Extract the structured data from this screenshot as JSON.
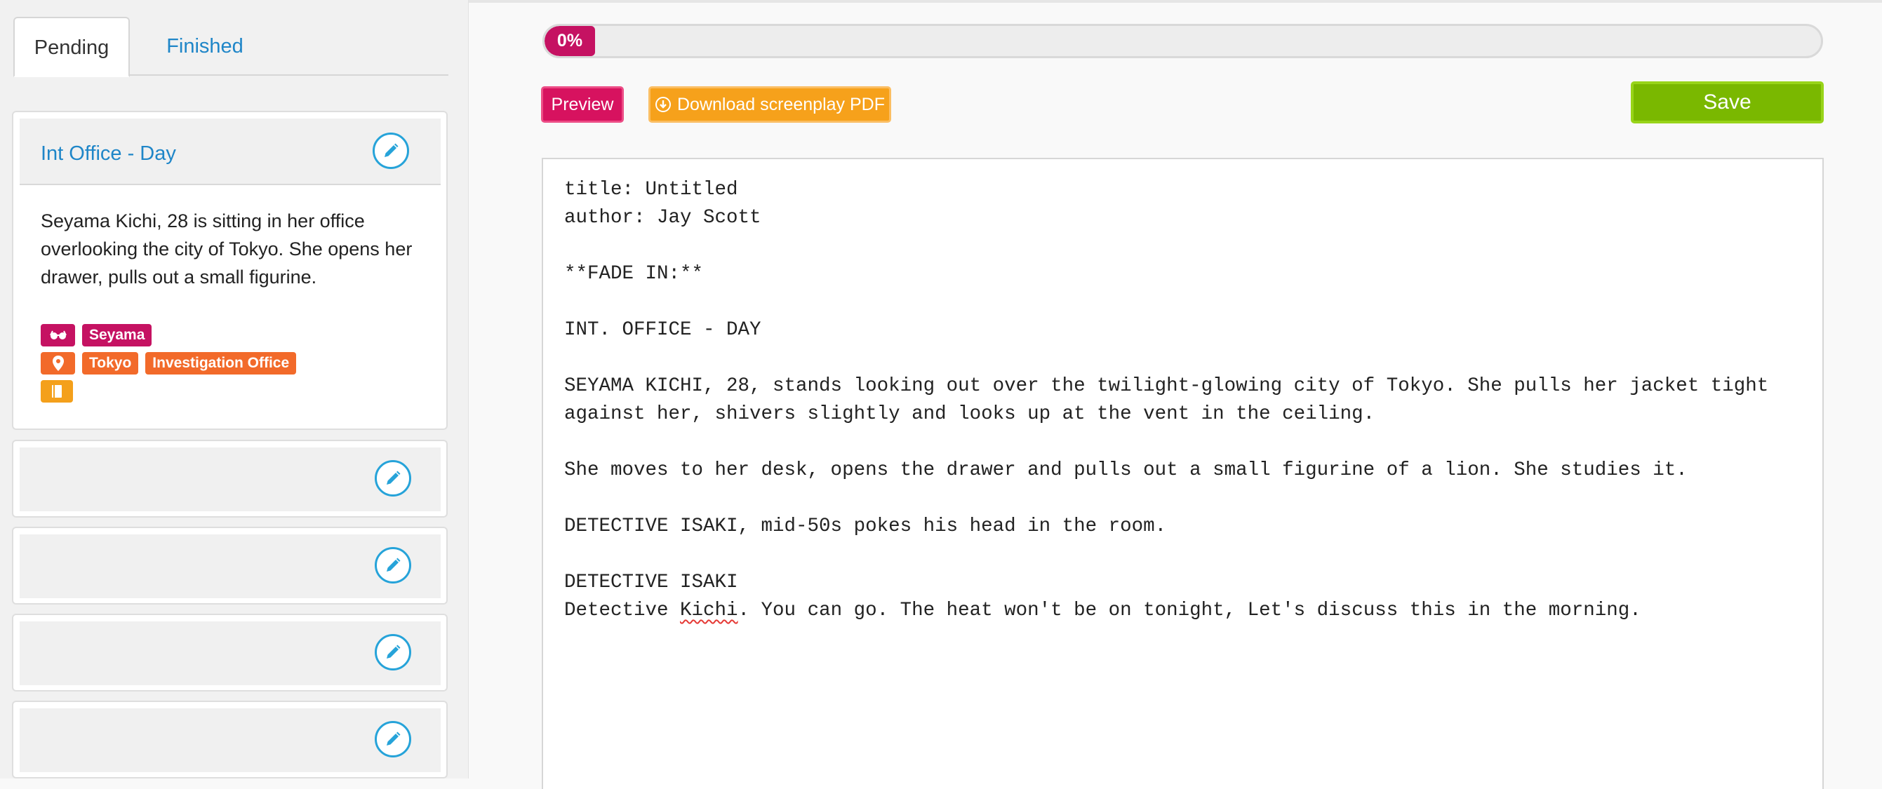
{
  "tabs": {
    "pending_label": "Pending",
    "finished_label": "Finished"
  },
  "scenes": {
    "active": {
      "title": "Int Office - Day",
      "description": "Seyama Kichi, 28 is sitting in her office overlooking the city of Tokyo. She opens her drawer, pulls out a small figurine.",
      "character_tags": [
        "Seyama"
      ],
      "location_tags": [
        "Tokyo",
        "Investigation Office"
      ],
      "tag_icons": {
        "characters": "glasses-icon",
        "locations": "map-pin-icon",
        "notes": "notebook-icon"
      }
    },
    "collapsed_count": 4
  },
  "progress": {
    "label": "0%",
    "value": 0
  },
  "toolbar": {
    "preview_label": "Preview",
    "download_label": "Download screenplay PDF",
    "save_label": "Save"
  },
  "script": {
    "lines": [
      "title: Untitled",
      "author: Jay Scott",
      "",
      "**FADE IN:**",
      "",
      "INT. OFFICE - DAY",
      "",
      "SEYAMA KICHI, 28, stands looking out over the twilight-glowing city of Tokyo. She pulls her jacket tight",
      "against her, shivers slightly and looks up at the vent in the ceiling.",
      "",
      "She moves to her desk, opens the drawer and pulls out a small figurine of a lion. She studies it.",
      "",
      "DETECTIVE ISAKI, mid-50s pokes his head in the room.",
      "",
      "DETECTIVE ISAKI"
    ],
    "last_line_before": "Detective ",
    "last_line_misspelled": "Kichi",
    "last_line_after": ". You can go. The heat won't be on tonight, Let's discuss this in the morning."
  },
  "colors": {
    "accent_crimson": "#c51262",
    "accent_orange": "#f26a2a",
    "accent_amber": "#f4a01b",
    "save_green": "#7ab800",
    "link_blue": "#1f86c8",
    "edit_ring": "#26a3d9"
  }
}
